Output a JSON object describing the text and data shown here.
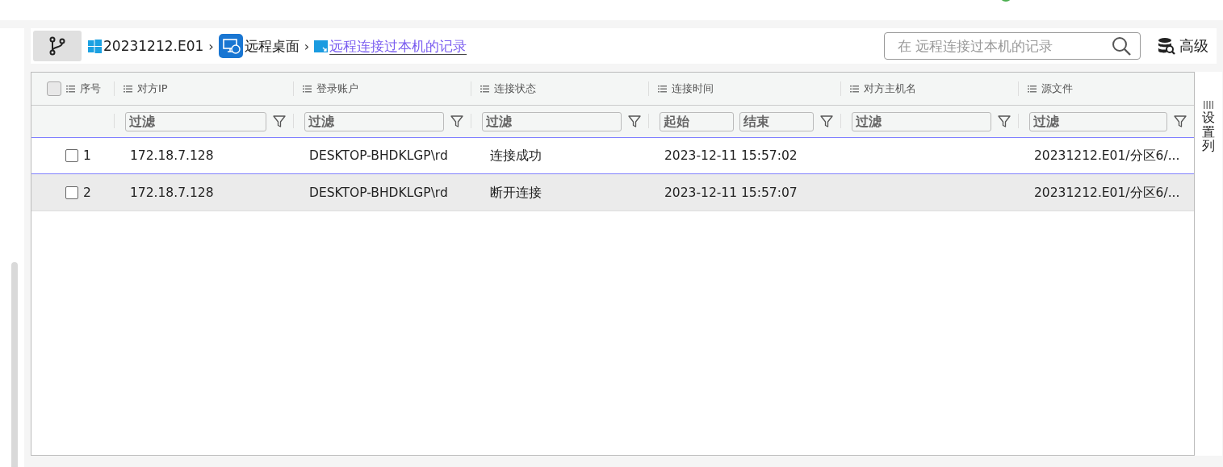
{
  "breadcrumb": [
    {
      "kind": "windows",
      "label": "20231212.E01",
      "link": false
    },
    {
      "kind": "remote",
      "label": "远程桌面",
      "link": false,
      "separator": "›"
    },
    {
      "kind": "record",
      "label": "远程连接过本机的记录",
      "link": true,
      "separator": "›"
    }
  ],
  "search": {
    "placeholder": "在 远程连接过本机的记录"
  },
  "advanced_button": "高级",
  "table": {
    "all_checked": false,
    "columns": [
      {
        "label": "序号",
        "kind": "plain"
      },
      {
        "label": "对方IP",
        "kind": "text",
        "placeholder": "过滤"
      },
      {
        "label": "登录账户",
        "kind": "text",
        "placeholder": "过滤"
      },
      {
        "label": "连接状态",
        "kind": "text",
        "placeholder": "过滤"
      },
      {
        "label": "连接时间",
        "kind": "range",
        "placeholder": "起始",
        "placeholder_end": "结束"
      },
      {
        "label": "对方主机名",
        "kind": "text",
        "placeholder": "过滤"
      },
      {
        "label": "源文件",
        "kind": "text",
        "placeholder": "过滤"
      }
    ],
    "rows": [
      {
        "selected": true,
        "highlighted": false,
        "checked": false,
        "cells": [
          "1",
          "172.18.7.128",
          "DESKTOP-BHDKLGP\\rd",
          "连接成功",
          "2023-12-11 15:57:02",
          "",
          "20231212.E01/分区6/..."
        ]
      },
      {
        "selected": false,
        "highlighted": true,
        "checked": false,
        "cells": [
          "2",
          "172.18.7.128",
          "DESKTOP-BHDKLGP\\rd",
          "断开连接",
          "2023-12-11 15:57:07",
          "",
          "20231212.E01/分区6/..."
        ]
      }
    ]
  },
  "column_settings": "设置列"
}
